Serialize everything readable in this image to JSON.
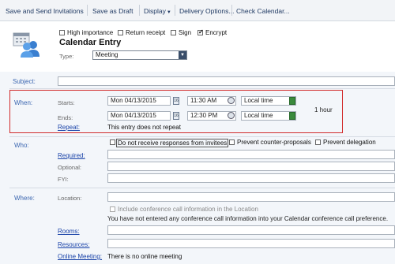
{
  "toolbar": {
    "send_label": "Save and Send Invitations",
    "draft_label": "Save as Draft",
    "display_label": "Display",
    "delivery_label": "Delivery Options...",
    "check_label": "Check Calendar..."
  },
  "options": {
    "high_importance": "High importance",
    "return_receipt": "Return receipt",
    "sign": "Sign",
    "encrypt": "Encrypt"
  },
  "entry": {
    "title": "Calendar Entry",
    "type_label": "Type:",
    "type_value": "Meeting"
  },
  "subject": {
    "label": "Subject:",
    "value": ""
  },
  "when": {
    "label": "When:",
    "starts_label": "Starts:",
    "ends_label": "Ends:",
    "start_date": "Mon 04/13/2015",
    "start_time": "11:30 AM",
    "start_zone": "Local time",
    "end_date": "Mon 04/13/2015",
    "end_time": "12:30 PM",
    "end_zone": "Local time",
    "duration": "1 hour",
    "calendar_glyph": "16",
    "repeat_link": "Repeat:",
    "repeat_text": "This entry does not repeat"
  },
  "who": {
    "label": "Who:",
    "no_responses": "Do not receive responses from invitees",
    "prevent_counter": "Prevent counter-proposals",
    "prevent_delegation": "Prevent delegation",
    "required_link": "Required:",
    "optional_label": "Optional:",
    "fyi_label": "FYI:"
  },
  "where": {
    "label": "Where:",
    "location_label": "Location:",
    "include_conf": "Include conference call information in the Location",
    "conf_note": "You have not entered any conference call information into your Calendar conference call preference.",
    "rooms_link": "Rooms:",
    "resources_link": "Resources:",
    "online_link": "Online Meeting:",
    "online_value": "There is no online meeting"
  },
  "icons": {
    "calendar": "calendar-icon",
    "people": "people-icon",
    "clock": "clock-icon",
    "spinner": "spinner-icon",
    "dropdown": "chevron-down-icon"
  },
  "colors": {
    "highlight_border": "#d12b2b",
    "link": "#1a43a8",
    "section_label": "#3b66b0"
  }
}
